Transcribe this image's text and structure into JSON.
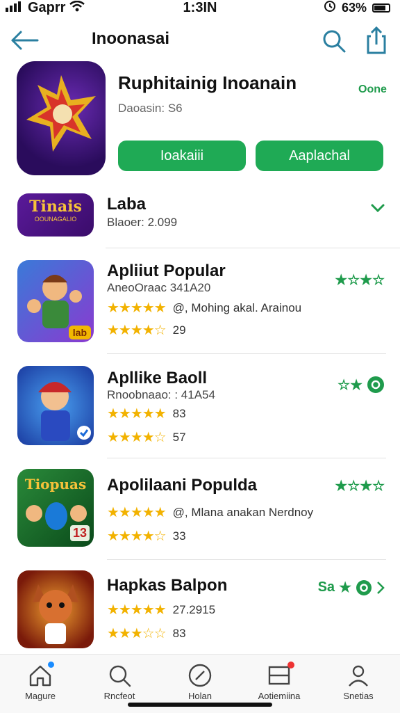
{
  "status_bar": {
    "carrier": "Gaprr",
    "time": "1:3IN",
    "battery": "63%"
  },
  "nav": {
    "title": "Inoonasai"
  },
  "hero": {
    "name": "Ruphitainig Inoanain",
    "subtitle": "Daoasin: S6",
    "badge": "Oone",
    "button_primary": "Ioakaiii",
    "button_secondary": "Aaplachal"
  },
  "rows": [
    {
      "icon_text": "Tinais",
      "icon_subtext": "OOUNAGALIO",
      "title": "Laba",
      "sub": "Blaoer: 2.099",
      "right": "chevron-down"
    },
    {
      "icon_text": "lab",
      "title": "Apliiut Popular",
      "sub": "AneoOraac 341A20",
      "line1_stars": "★★★★★",
      "line1_text": "@, Mohing akal. Arainou",
      "line2_stars": "★★★★☆",
      "line2_text": "29",
      "right_stars": "★☆★☆"
    },
    {
      "title": "Apllike Baoll",
      "sub": "Rnoobnaao: : 41A54",
      "line1_stars": "★★★★★",
      "line1_text": "83",
      "line2_stars": "★★★★☆",
      "line2_text": "57",
      "right_stars": "☆★"
    },
    {
      "icon_text": "Tiopuas",
      "icon_badge": "13",
      "title": "Apolilaani Populda",
      "sub": "",
      "line1_stars": "★★★★★",
      "line1_text": "@, Mlana anakan Nerdnoy",
      "line2_stars": "★★★★☆",
      "line2_text": "33",
      "right_stars": "★☆★☆"
    },
    {
      "title": "Hapkas Balpon",
      "sub": "",
      "line1_stars": "★★★★★",
      "line1_text": "27.2915",
      "line2_stars": "★★★☆☆",
      "line2_text": "83",
      "right_prefix": "Sa"
    }
  ],
  "tabs": [
    {
      "label": "Magure",
      "icon": "home-icon"
    },
    {
      "label": "Rncfeot",
      "icon": "search-icon"
    },
    {
      "label": "Holan",
      "icon": "compass-icon"
    },
    {
      "label": "Aotiemiina",
      "icon": "inbox-icon"
    },
    {
      "label": "Snetias",
      "icon": "person-icon"
    }
  ],
  "colors": {
    "accent": "#1f9b4c",
    "button": "#1faa55",
    "star": "#f2b200",
    "icon_teal": "#2a7fa0"
  }
}
